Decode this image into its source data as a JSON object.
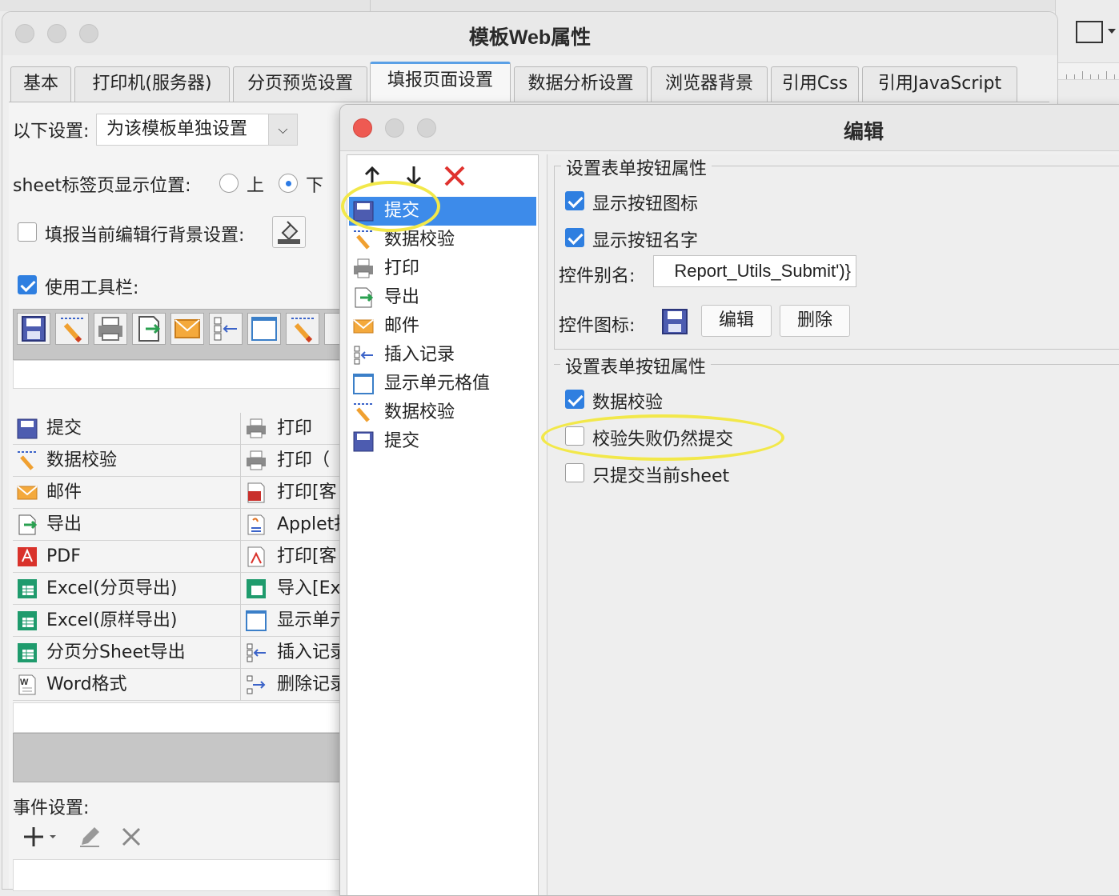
{
  "main_window": {
    "title": "模板Web属性",
    "tabs": [
      "基本",
      "打印机(服务器)",
      "分页预览设置",
      "填报页面设置",
      "数据分析设置",
      "浏览器背景",
      "引用Css",
      "引用JavaScript"
    ],
    "active_tab": "填报页面设置"
  },
  "settings": {
    "scope_label": "以下设置:",
    "scope_value": "为该模板单独设置",
    "sheet_tab_label": "sheet标签页显示位置:",
    "sheet_tab_top": "上",
    "sheet_tab_bottom": "下",
    "sheet_tab_selected": "下",
    "row_bg_label": "填报当前编辑行背景设置:",
    "row_bg_checked": false,
    "use_toolbar_label": "使用工具栏:",
    "use_toolbar_checked": true,
    "event_label": "事件设置:"
  },
  "toolbar_buttons": [
    "save-icon",
    "pencil-icon",
    "printer-icon",
    "export-icon",
    "mail-icon",
    "insert-record-icon",
    "cell-icon",
    "pencil-icon"
  ],
  "button_grid": {
    "left": [
      "提交",
      "数据校验",
      "邮件",
      "导出",
      "PDF",
      "Excel(分页导出)",
      "Excel(原样导出)",
      "分页分Sheet导出",
      "Word格式"
    ],
    "right": [
      "打印",
      "打印（",
      "打印[客",
      "Applet打",
      "打印[客",
      "导入[Ex",
      "显示单元",
      "插入记录",
      "删除记录"
    ]
  },
  "editor_dialog": {
    "title": "编辑",
    "list_items": [
      "提交",
      "数据校验",
      "打印",
      "导出",
      "邮件",
      "插入记录",
      "显示单元格值",
      "数据校验",
      "提交"
    ],
    "selected_index": 0,
    "group1": {
      "title": "设置表单按钮属性",
      "show_icon_label": "显示按钮图标",
      "show_icon_checked": true,
      "show_name_label": "显示按钮名字",
      "show_name_checked": true,
      "alias_label": "控件别名:",
      "alias_value": "Report_Utils_Submit')}",
      "icon_label": "控件图标:",
      "edit_button": "编辑",
      "delete_button": "删除"
    },
    "group2": {
      "title": "设置表单按钮属性",
      "data_verify_label": "数据校验",
      "data_verify_checked": true,
      "submit_on_fail_label": "校验失败仍然提交",
      "submit_on_fail_checked": false,
      "submit_current_sheet_label": "只提交当前sheet",
      "submit_current_sheet_checked": false
    }
  },
  "colors": {
    "accent": "#3d8bea",
    "highlight_circle": "#f2e84a",
    "delete_red": "#e0322e"
  }
}
